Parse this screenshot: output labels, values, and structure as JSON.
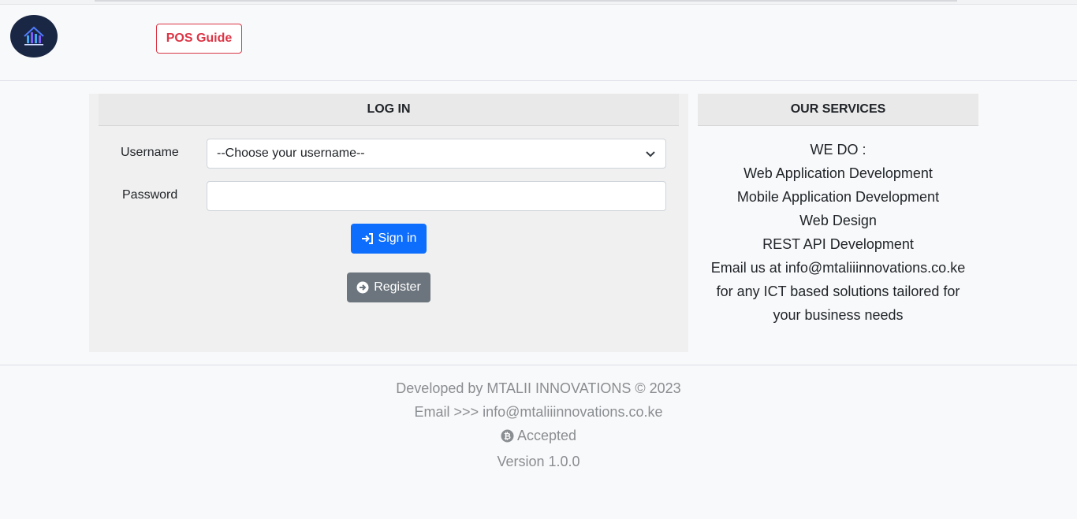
{
  "header": {
    "logo_alt": "MTALII INNOVATIONS",
    "pos_guide_label": "POS Guide"
  },
  "login": {
    "title": "LOG IN",
    "username_label": "Username",
    "username_value": "--Choose your username--",
    "password_label": "Password",
    "password_value": "",
    "signin_label": "Sign in",
    "register_label": "Register"
  },
  "services": {
    "title": "OUR SERVICES",
    "lines": [
      "WE DO :",
      "Web Application Development",
      "Mobile Application Development",
      "Web Design",
      "REST API Development",
      "Email us at info@mtaliiinnovations.co.ke",
      "for any ICT based solutions tailored for",
      "your business needs"
    ]
  },
  "footer": {
    "developed": "Developed by MTALII INNOVATIONS © 2023",
    "email": "Email >>> info@mtaliiinnovations.co.ke",
    "accepted": "Accepted",
    "version": "Version 1.0.0"
  },
  "colors": {
    "primary": "#0d6efd",
    "secondary": "#6c757d",
    "danger": "#dc3545"
  }
}
